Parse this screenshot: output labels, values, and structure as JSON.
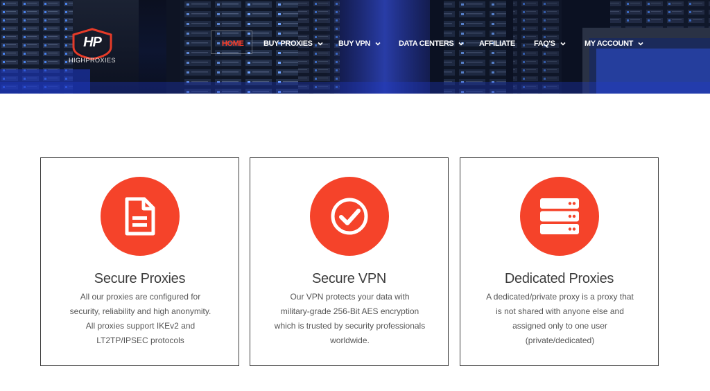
{
  "header": {
    "logo": {
      "mark": "HP",
      "brand_prefix": "HIGH",
      "brand_suffix": "PROXIES"
    },
    "nav": [
      {
        "label": "HOME",
        "active": true,
        "dropdown": false
      },
      {
        "label": "BUY PROXIES",
        "active": false,
        "dropdown": true
      },
      {
        "label": "BUY VPN",
        "active": false,
        "dropdown": true
      },
      {
        "label": "DATA CENTERS",
        "active": false,
        "dropdown": true
      },
      {
        "label": "AFFILIATE",
        "active": false,
        "dropdown": false
      },
      {
        "label": "FAQ'S",
        "active": false,
        "dropdown": true
      },
      {
        "label": "MY ACCOUNT",
        "active": false,
        "dropdown": true
      }
    ]
  },
  "features": [
    {
      "icon": "document-icon",
      "title": "Secure Proxies",
      "lines": [
        "All our proxies are configured for",
        "security, reliability and high anonymity.",
        "All proxies support IKEv2 and",
        "LT2TP/IPSEC protocols"
      ]
    },
    {
      "icon": "check-circle-icon",
      "title": "Secure VPN",
      "lines": [
        "Our VPN protects your data with",
        "military-grade 256-Bit AES encryption",
        "which is trusted by security professionals",
        "worldwide."
      ]
    },
    {
      "icon": "server-icon",
      "title": "Dedicated Proxies",
      "lines": [
        "A dedicated/private proxy is a proxy that",
        "is not shared with anyone else and",
        "assigned only to one user",
        "(private/dedicated)"
      ]
    }
  ],
  "colors": {
    "accent": "#f5432a",
    "nav_active": "#ff3b25",
    "hero_bg": "#0b1020",
    "text_title": "#3d3d3d",
    "text_body": "#555555"
  }
}
